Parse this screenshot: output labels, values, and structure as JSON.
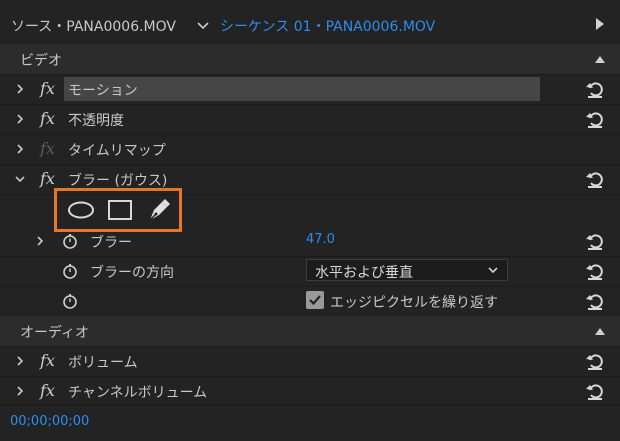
{
  "header": {
    "source_tab": "ソース・PANA0006.MOV",
    "sequence_tab": "シーケンス 01・PANA0006.MOV"
  },
  "sections": {
    "video": "ビデオ",
    "audio": "オーディオ"
  },
  "effects": {
    "fx_symbol": "fx",
    "motion": "モーション",
    "opacity": "不透明度",
    "time_remap": "タイムリマップ",
    "blur": "ブラー (ガウス)",
    "volume": "ボリューム",
    "channel_volume": "チャンネルボリューム"
  },
  "blur_props": {
    "blurriness_label": "ブラー",
    "blurriness_value": "47.0",
    "direction_label": "ブラーの方向",
    "direction_value": "水平および垂直",
    "repeat_edge_label": "エッジピクセルを繰り返す",
    "repeat_edge_checked": true
  },
  "footer": {
    "timecode": "00;00;00;00"
  },
  "colors": {
    "accent_blue": "#2d8ceb",
    "mask_highlight": "#e8742a"
  },
  "icons": [
    "chevron-down-icon",
    "play-arrow-icon",
    "collapse-up-icon",
    "expand-right-icon",
    "expand-down-icon",
    "reset-icon",
    "ellipse-mask-icon",
    "rectangle-mask-icon",
    "pen-mask-icon",
    "stopwatch-icon",
    "checkbox-checked-icon"
  ]
}
